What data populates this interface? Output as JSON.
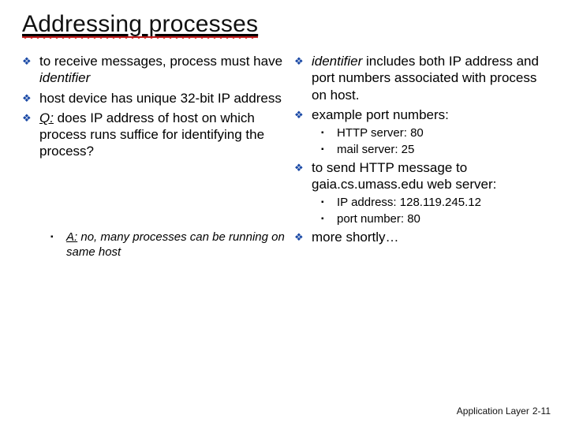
{
  "title": "Addressing processes",
  "left": {
    "b1": {
      "pre": "to receive messages, process  must have ",
      "em": "identifier"
    },
    "b2": "host device has unique 32-bit IP address",
    "b3": {
      "q": "Q:",
      "rest": " does  IP address of host on which process runs suffice for identifying the process?"
    },
    "ans": {
      "a": "A:",
      "rest": " no, many processes can be running on same host"
    }
  },
  "right": {
    "b1": {
      "em": "identifier",
      "rest": " includes both IP address and port numbers associated with process on host."
    },
    "b2": "example port numbers:",
    "b2s1": "HTTP server: 80",
    "b2s2": "mail server: 25",
    "b3": "to send HTTP message to gaia.cs.umass.edu web server:",
    "b3s1": "IP address: 128.119.245.12",
    "b3s2": "port number: 80",
    "b4": "more shortly…"
  },
  "footer": {
    "section": "Application Layer",
    "page": "2-11"
  },
  "marks": {
    "diamond": "❖",
    "square": "▪"
  }
}
